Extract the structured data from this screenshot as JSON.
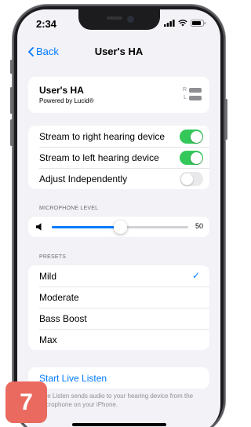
{
  "status_bar": {
    "time": "2:34"
  },
  "nav": {
    "back_label": "Back",
    "title": "User's HA"
  },
  "device": {
    "name": "User's HA",
    "subtitle": "Powered by Lucid®",
    "right_label": "R",
    "left_label": "L"
  },
  "streaming": {
    "items": [
      {
        "label": "Stream to right hearing device",
        "on": true
      },
      {
        "label": "Stream to left hearing device",
        "on": true
      },
      {
        "label": "Adjust Independently",
        "on": false
      }
    ]
  },
  "microphone": {
    "section_label": "MICROPHONE LEVEL",
    "value": "50",
    "level_percent": 50
  },
  "presets": {
    "section_label": "PRESETS",
    "items": [
      "Mild",
      "Moderate",
      "Bass Boost",
      "Max"
    ],
    "selected": "Mild"
  },
  "live_listen": {
    "label": "Start Live Listen",
    "footer": "Live Listen sends audio to your hearing device from the microphone on your iPhone."
  },
  "badge": {
    "number": "7"
  },
  "colors": {
    "accent": "#007aff",
    "toggle_on": "#34c759",
    "badge": "#ea6a5f",
    "background": "#f2f2f7"
  }
}
